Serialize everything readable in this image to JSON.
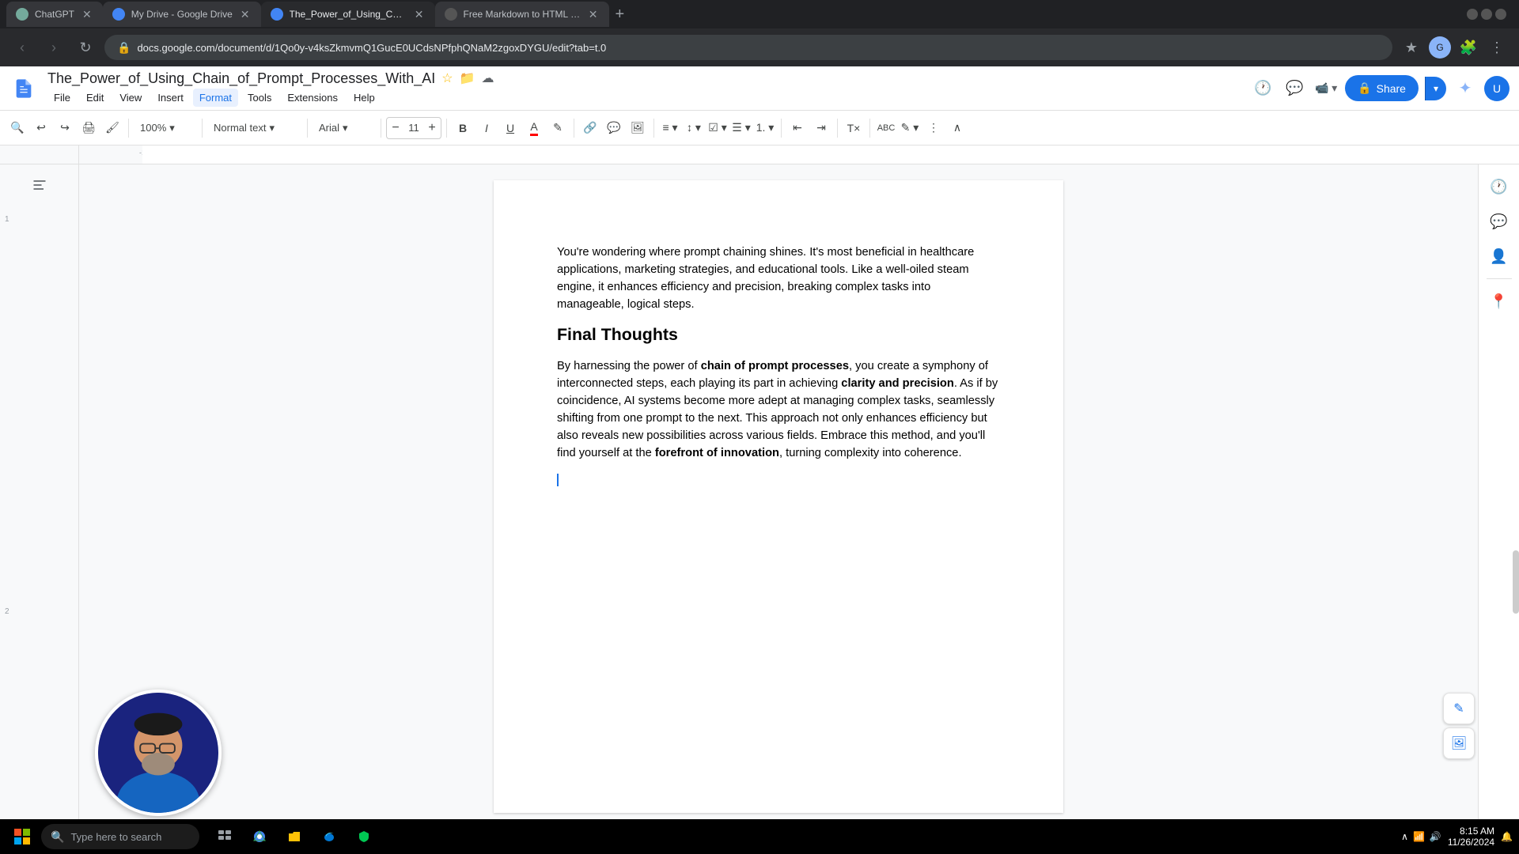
{
  "browser": {
    "tabs": [
      {
        "id": "chatgpt",
        "title": "ChatGPT",
        "favicon_color": "#74aa9c",
        "active": false
      },
      {
        "id": "gdrive",
        "title": "My Drive - Google Drive",
        "favicon_color": "#4285f4",
        "active": false
      },
      {
        "id": "gdocs",
        "title": "The_Power_of_Using_Chain_of_",
        "favicon_color": "#4285f4",
        "active": true
      },
      {
        "id": "markdown",
        "title": "Free Markdown to HTML Conv",
        "favicon_color": "#555",
        "active": false
      }
    ],
    "address": "docs.google.com/document/d/1Qo0y-v4ksZkmvmQ1GucE0UCdsNPfphQNaM2zgoxDYGU/edit?tab=t.0",
    "nav": {
      "back_disabled": false,
      "forward_disabled": true
    }
  },
  "docs": {
    "filename": "The_Power_of_Using_Chain_of_Prompt_Processes_With_AI",
    "menu": {
      "items": [
        "File",
        "Edit",
        "View",
        "Insert",
        "Format",
        "Tools",
        "Extensions",
        "Help"
      ]
    },
    "toolbar": {
      "search_label": "🔍",
      "undo_label": "↩",
      "redo_label": "↪",
      "print_label": "🖨",
      "paint_label": "🖌",
      "zoom": "100%",
      "zoom_chevron": "▾",
      "style_label": "Normal text",
      "style_chevron": "▾",
      "font_label": "Arial",
      "font_chevron": "▾",
      "font_size_minus": "−",
      "font_size": "11",
      "font_size_plus": "+",
      "bold": "B",
      "italic": "I",
      "underline": "U",
      "text_color": "A",
      "highlight": "✎",
      "link": "🔗",
      "comment": "💬",
      "image": "🖼",
      "align": "≡",
      "line_spacing": "↕",
      "checklist": "☑",
      "bullets": "☰",
      "numbered": "1.",
      "decrease_indent": "⇤",
      "increase_indent": "⇥",
      "clear_format": "T×",
      "spelling": "ABC",
      "edit_mode": "✎",
      "format_options": "⋮",
      "collapse": "∧"
    },
    "content": {
      "intro_paragraph": "You're wondering where prompt chaining shines. It's most beneficial in healthcare applications, marketing strategies, and educational tools. Like a well-oiled steam engine, it enhances efficiency and precision, breaking complex tasks into manageable, logical steps.",
      "final_thoughts_heading": "Final Thoughts",
      "final_paragraph": "By harnessing the power of chain of prompt processes, you create a symphony of interconnected steps, each playing its part in achieving clarity and precision. As if by coincidence, AI systems become more adept at managing complex tasks, seamlessly shifting from one prompt to the next. This approach not only enhances efficiency but also reveals new possibilities across various fields. Embrace this method, and you'll find yourself at the forefront of innovation, turning complexity into coherence."
    }
  },
  "right_sidebar": {
    "history_icon": "🕐",
    "comment_icon": "💬",
    "people_icon": "👤",
    "location_icon": "📍",
    "add_icon": "+"
  },
  "float_panel": {
    "edit_icon": "✎",
    "image_icon": "🖼"
  },
  "taskbar": {
    "search_placeholder": "Type here to search",
    "time": "8:15 AM",
    "date": "11/26/2024",
    "apps": [
      "⊞",
      "🔍",
      "📁",
      "🌐",
      "🔵"
    ]
  }
}
